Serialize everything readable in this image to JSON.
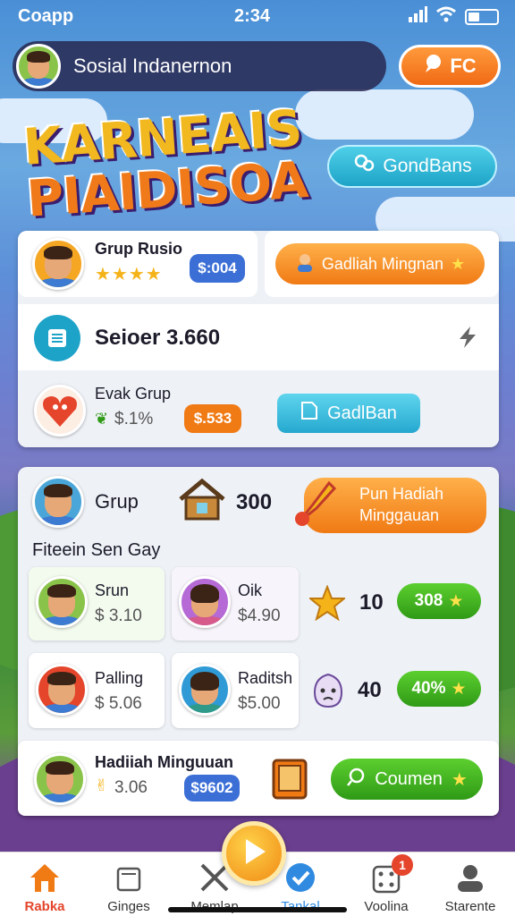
{
  "status": {
    "carrier": "Coapp",
    "time": "2:34"
  },
  "header": {
    "title": "Sosial Indanernon",
    "fc_label": "FC"
  },
  "logo": {
    "line1": "KARNEAIS",
    "line2": "PIAIDISOA"
  },
  "gond_button": {
    "label": "GondBans"
  },
  "top_group": {
    "name": "Grup Rusio",
    "stars": "★★★★",
    "badge": "$:004",
    "reward_button": "Gadliah Mingnan",
    "score_label": "Seioer 3.660",
    "evak_name": "Evak Grup",
    "evak_pct": "$.1%",
    "evak_badge": "$.533",
    "gadlban_button": "GadlBan"
  },
  "group_panel": {
    "group_label": "Grup",
    "group_count": "300",
    "reward_button_line1": "Pun Hadiah",
    "reward_button_line2": "Minggauan",
    "section_title": "Fiteein Sen Gay"
  },
  "members": [
    {
      "name": "Srun",
      "price": "$ 3.10"
    },
    {
      "name": "Oik",
      "price": "$4.90"
    },
    {
      "name": "Palling",
      "price": "$ 5.06"
    },
    {
      "name": "Raditsh",
      "price": "$5.00"
    }
  ],
  "rewards": [
    {
      "count": "10",
      "pct": "308"
    },
    {
      "count": "40",
      "pct": "40%"
    }
  ],
  "bottom_row": {
    "name": "Hadiiah Minguuan",
    "price": "3.06",
    "badge": "$9602",
    "button": "Coumen"
  },
  "nav": [
    {
      "label": "Rabka",
      "icon": "home-icon"
    },
    {
      "label": "Ginges",
      "icon": "cart-icon"
    },
    {
      "label": "Memlap",
      "icon": "tools-icon"
    },
    {
      "label": "Tankal",
      "icon": "check-icon"
    },
    {
      "label": "Voolina",
      "icon": "dice-icon",
      "badge": "1"
    },
    {
      "label": "Starente",
      "icon": "profile-icon"
    }
  ],
  "colors": {
    "accent_orange": "#f07a14",
    "accent_green": "#2f9a16",
    "accent_cyan": "#25a8cf",
    "badge_blue": "#3b6fd6"
  }
}
